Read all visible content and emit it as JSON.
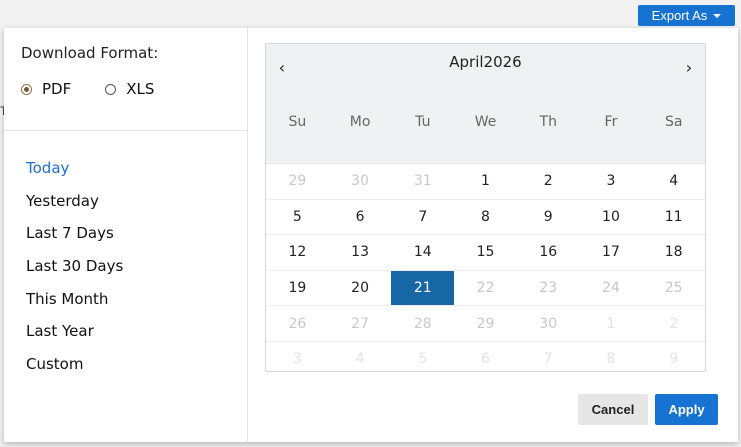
{
  "topbar": {
    "export_label": "Export As",
    "left_stub": "T"
  },
  "format": {
    "title": "Download Format:",
    "options": [
      {
        "label": "PDF",
        "checked": true
      },
      {
        "label": "XLS",
        "checked": false
      }
    ]
  },
  "ranges": [
    "Today",
    "Yesterday",
    "Last 7 Days",
    "Last 30 Days",
    "This Month",
    "Last Year",
    "Custom"
  ],
  "active_range": "Today",
  "calendar": {
    "title": "April2026",
    "prev": "‹",
    "next": "›",
    "weekdays": [
      "Su",
      "Mo",
      "Tu",
      "We",
      "Th",
      "Fr",
      "Sa"
    ],
    "selected": "21",
    "weeks": [
      [
        {
          "d": "29",
          "s": "muted"
        },
        {
          "d": "30",
          "s": "muted"
        },
        {
          "d": "31",
          "s": "muted"
        },
        {
          "d": "1",
          "s": ""
        },
        {
          "d": "2",
          "s": ""
        },
        {
          "d": "3",
          "s": ""
        },
        {
          "d": "4",
          "s": ""
        }
      ],
      [
        {
          "d": "5",
          "s": ""
        },
        {
          "d": "6",
          "s": ""
        },
        {
          "d": "7",
          "s": ""
        },
        {
          "d": "8",
          "s": ""
        },
        {
          "d": "9",
          "s": ""
        },
        {
          "d": "10",
          "s": ""
        },
        {
          "d": "11",
          "s": ""
        }
      ],
      [
        {
          "d": "12",
          "s": ""
        },
        {
          "d": "13",
          "s": ""
        },
        {
          "d": "14",
          "s": ""
        },
        {
          "d": "15",
          "s": ""
        },
        {
          "d": "16",
          "s": ""
        },
        {
          "d": "17",
          "s": ""
        },
        {
          "d": "18",
          "s": ""
        }
      ],
      [
        {
          "d": "19",
          "s": ""
        },
        {
          "d": "20",
          "s": ""
        },
        {
          "d": "21",
          "s": "selected"
        },
        {
          "d": "22",
          "s": "muted"
        },
        {
          "d": "23",
          "s": "muted"
        },
        {
          "d": "24",
          "s": "muted"
        },
        {
          "d": "25",
          "s": "muted"
        }
      ],
      [
        {
          "d": "26",
          "s": "muted"
        },
        {
          "d": "27",
          "s": "muted"
        },
        {
          "d": "28",
          "s": "muted"
        },
        {
          "d": "29",
          "s": "muted"
        },
        {
          "d": "30",
          "s": "muted"
        },
        {
          "d": "1",
          "s": "faint"
        },
        {
          "d": "2",
          "s": "faint"
        }
      ],
      [
        {
          "d": "3",
          "s": "faint"
        },
        {
          "d": "4",
          "s": "faint"
        },
        {
          "d": "5",
          "s": "faint"
        },
        {
          "d": "6",
          "s": "faint"
        },
        {
          "d": "7",
          "s": "faint"
        },
        {
          "d": "8",
          "s": "faint"
        },
        {
          "d": "9",
          "s": "faint"
        }
      ]
    ]
  },
  "actions": {
    "cancel": "Cancel",
    "apply": "Apply"
  },
  "colors": {
    "accent": "#1673d2",
    "selected_day": "#1667a3",
    "active_range": "#1e6fd0"
  }
}
